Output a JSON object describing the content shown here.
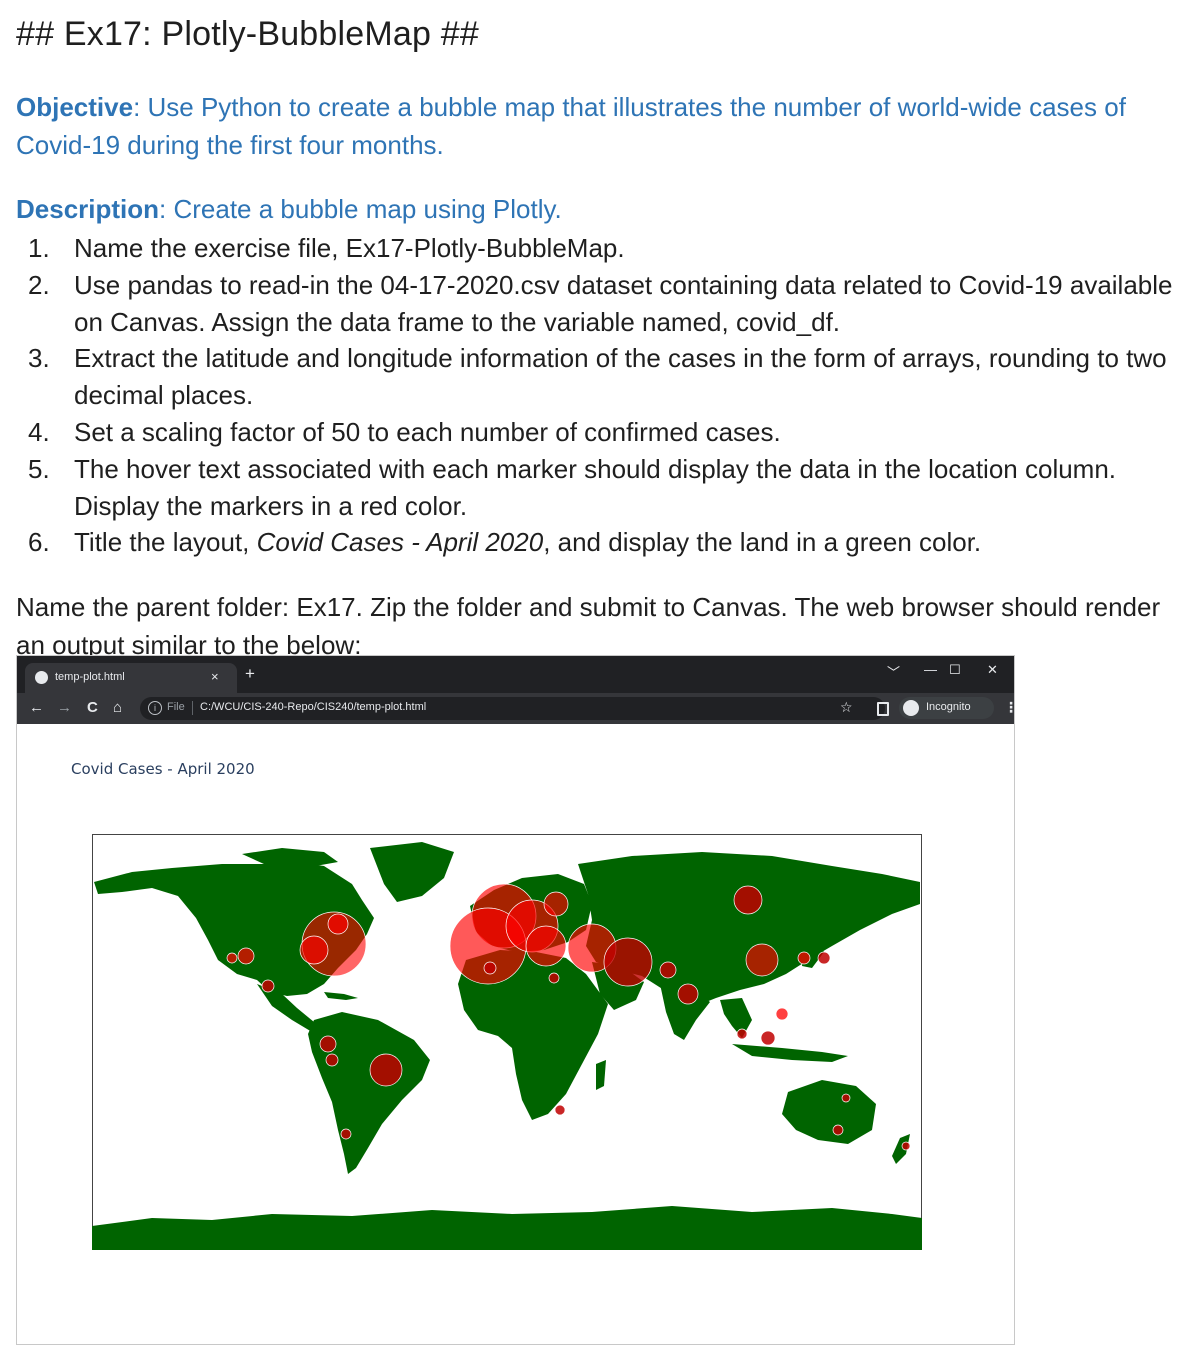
{
  "heading": "## Ex17: Plotly-BubbleMap ##",
  "objective": {
    "label": "Objective",
    "text": ": Use Python to create a bubble map that illustrates the number of world-wide cases of Covid-19 during the first four months."
  },
  "description": {
    "label": "Description",
    "text": ": Create a bubble map using Plotly."
  },
  "steps": [
    {
      "num": "1.",
      "text": "Name the exercise file, Ex17-Plotly-BubbleMap."
    },
    {
      "num": "2.",
      "text": "Use pandas to read-in the 04-17-2020.csv dataset containing data related to Covid-19 available on Canvas. Assign the data frame to the variable named, covid_df."
    },
    {
      "num": "3.",
      "text": "Extract the latitude and longitude information of the cases in the form of arrays, rounding to two decimal places."
    },
    {
      "num": "4.",
      "text": "Set a scaling factor of 50 to each number of confirmed cases."
    },
    {
      "num": "5.",
      "text": "The hover text associated with each marker should display the data in the location column. Display the markers in a red color."
    },
    {
      "num": "6.",
      "pre": "Title the layout, ",
      "italic": "Covid Cases - April 2020",
      "post": ", and display the land in a green color."
    }
  ],
  "closing": "Name the parent folder: Ex17. Zip the folder and submit to Canvas. The web browser should render an output similar to the below:",
  "browser": {
    "tab_title": "temp-plot.html",
    "tab_close": "×",
    "new_tab": "+",
    "win_chevron": "﹀",
    "win_min": "—",
    "win_max": "☐",
    "win_close": "✕",
    "back": "←",
    "forward": "→",
    "reload": "C",
    "home": "⌂",
    "info": "i",
    "file_label": "File",
    "url": "C:/WCU/CIS-240-Repo/CIS240/temp-plot.html",
    "star": "☆",
    "incognito": "Incognito",
    "menu": "⋮"
  },
  "plot": {
    "title": "Covid Cases - April 2020",
    "land_color": "#006400",
    "marker_color": "#ff0000"
  },
  "colors": {
    "heading_blue": "#2e74b5",
    "text": "#1f1f1f"
  }
}
